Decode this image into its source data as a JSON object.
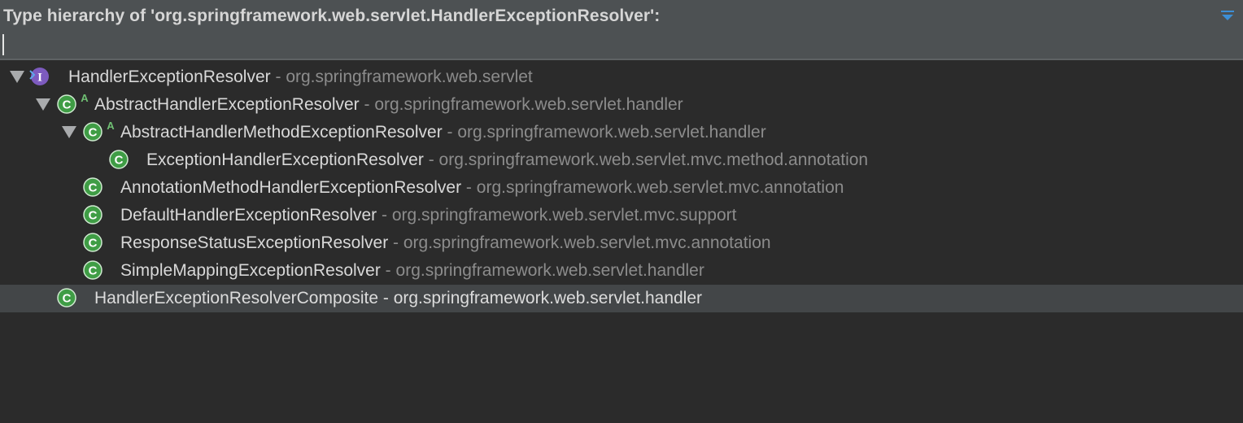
{
  "header": {
    "title": "Type hierarchy of 'org.springframework.web.servlet.HandlerExceptionResolver':",
    "menu_icon": "chevron-down-icon",
    "search_value": ""
  },
  "colors": {
    "background": "#2b2b2b",
    "header_background": "#4d5153",
    "selected_row": "#434648",
    "class_icon": "#3f9d45",
    "interface_icon": "#7d5bbf",
    "package_text": "#8c8c8c",
    "class_text": "#d8d8d8"
  },
  "tree": {
    "separator": " - ",
    "rows": [
      {
        "name": "HandlerExceptionResolver",
        "package": "org.springframework.web.servlet",
        "kind": "interface",
        "icon": "interface-icon",
        "expanded": true,
        "abstract": false,
        "selected": false
      },
      {
        "name": "AbstractHandlerExceptionResolver",
        "package": "org.springframework.web.servlet.handler",
        "kind": "class",
        "icon": "class-icon",
        "expanded": true,
        "abstract": true,
        "selected": false
      },
      {
        "name": "AbstractHandlerMethodExceptionResolver",
        "package": "org.springframework.web.servlet.handler",
        "kind": "class",
        "icon": "class-icon",
        "expanded": true,
        "abstract": true,
        "selected": false
      },
      {
        "name": "ExceptionHandlerExceptionResolver",
        "package": "org.springframework.web.servlet.mvc.method.annotation",
        "kind": "class",
        "icon": "class-icon",
        "expanded": false,
        "abstract": false,
        "selected": false
      },
      {
        "name": "AnnotationMethodHandlerExceptionResolver",
        "package": "org.springframework.web.servlet.mvc.annotation",
        "kind": "class",
        "icon": "class-icon",
        "expanded": false,
        "abstract": false,
        "selected": false
      },
      {
        "name": "DefaultHandlerExceptionResolver",
        "package": "org.springframework.web.servlet.mvc.support",
        "kind": "class",
        "icon": "class-icon",
        "expanded": false,
        "abstract": false,
        "selected": false
      },
      {
        "name": "ResponseStatusExceptionResolver",
        "package": "org.springframework.web.servlet.mvc.annotation",
        "kind": "class",
        "icon": "class-icon",
        "expanded": false,
        "abstract": false,
        "selected": false
      },
      {
        "name": "SimpleMappingExceptionResolver",
        "package": "org.springframework.web.servlet.handler",
        "kind": "class",
        "icon": "class-icon",
        "expanded": false,
        "abstract": false,
        "selected": false
      },
      {
        "name": "HandlerExceptionResolverComposite",
        "package": "org.springframework.web.servlet.handler",
        "kind": "class",
        "icon": "class-icon",
        "expanded": false,
        "abstract": false,
        "selected": true
      }
    ]
  }
}
